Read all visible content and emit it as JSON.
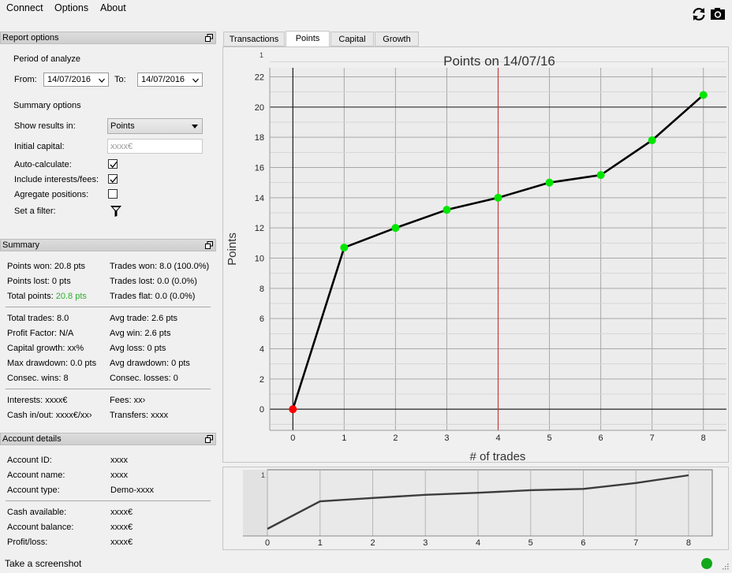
{
  "menu": [
    "Connect",
    "Options",
    "About"
  ],
  "toolbar": {
    "refresh_icon": "refresh-icon",
    "screenshot_icon": "camera-icon"
  },
  "report_options": {
    "header": "Report options",
    "period_label": "Period of analyze",
    "from_label": "From:",
    "from_value": "14/07/2016",
    "to_label": "To:",
    "to_value": "14/07/2016",
    "summary_options_label": "Summary options",
    "show_results_label": "Show results in:",
    "show_results_value": "Points",
    "initial_capital_label": "Initial capital:",
    "initial_capital_placeholder": "xxxx€",
    "auto_calc_label": "Auto-calculate:",
    "auto_calc_checked": true,
    "include_fees_label": "Include interests/fees:",
    "include_fees_checked": true,
    "aggregate_label": "Agregate positions:",
    "aggregate_checked": false,
    "filter_label": "Set a filter:"
  },
  "summary": {
    "header": "Summary",
    "points_won": "Points won: 20.8 pts",
    "trades_won": "Trades won: 8.0 (100.0%)",
    "points_lost": "Points lost: 0 pts",
    "trades_lost": "Trades lost: 0.0 (0.0%)",
    "total_points_label": "Total points:",
    "total_points_value": "20.8 pts",
    "trades_flat": "Trades flat: 0.0 (0.0%)",
    "total_trades": "Total trades: 8.0",
    "avg_trade": "Avg trade: 2.6 pts",
    "profit_factor": "Profit Factor: N/A",
    "avg_win": "Avg win: 2.6 pts",
    "capital_growth": "Capital growth: xx%",
    "avg_loss": "Avg loss: 0 pts",
    "max_drawdown": "Max drawdown: 0.0 pts",
    "avg_drawdown": "Avg drawdown: 0 pts",
    "consec_wins": "Consec. wins: 8",
    "consec_losses": "Consec. losses: 0",
    "interests": "Interests: xxxx€",
    "fees": "Fees: xx›",
    "cash_inout": "Cash in/out: xxxx€/xx›",
    "transfers": "Transfers: xxxx"
  },
  "account": {
    "header": "Account details",
    "rows1": [
      {
        "label": "Account ID:",
        "value": "xxxx"
      },
      {
        "label": "Account name:",
        "value": "xxxx"
      },
      {
        "label": "Account type:",
        "value": "Demo-xxxx"
      }
    ],
    "rows2": [
      {
        "label": "Cash available:",
        "value": "xxxx€"
      },
      {
        "label": "Account balance:",
        "value": "xxxx€"
      },
      {
        "label": "Profit/loss:",
        "value": "xxxx€"
      }
    ]
  },
  "tabs": [
    "Transactions",
    "Points",
    "Capital",
    "Growth"
  ],
  "active_tab": 1,
  "status": {
    "screenshot_label": "Take a screenshot",
    "status_color": "#11a819"
  },
  "chart_data": [
    {
      "type": "line",
      "title": "Points on 14/07/16",
      "xlabel": "# of trades",
      "ylabel": "Points",
      "x": [
        0,
        1,
        2,
        3,
        4,
        5,
        6,
        7,
        8
      ],
      "values": [
        0,
        10.7,
        12.0,
        13.2,
        14.0,
        15.0,
        15.5,
        17.8,
        20.8
      ],
      "xlim": [
        -0.45,
        8.45
      ],
      "ylim": [
        -1.4,
        22.6
      ],
      "yticks": [
        0,
        2,
        4,
        6,
        8,
        10,
        12,
        14,
        16,
        18,
        20,
        22
      ],
      "xticks": [
        0,
        1,
        2,
        3,
        4,
        5,
        6,
        7,
        8
      ],
      "corner_label": "1",
      "hline": 20,
      "vline": 4,
      "grid": true,
      "point_colors": {
        "first": "#ff0000",
        "rest": "#00e600"
      },
      "line_color": "#000000",
      "vline_color": "#c83c3c"
    },
    {
      "type": "line",
      "title": "",
      "x": [
        0,
        1,
        2,
        3,
        4,
        5,
        6,
        7,
        8
      ],
      "values": [
        0,
        10.7,
        12.0,
        13.2,
        14.0,
        15.0,
        15.5,
        17.8,
        20.8
      ],
      "xticks": [
        0,
        1,
        2,
        3,
        4,
        5,
        6,
        7,
        8
      ],
      "corner_label": "1",
      "line_color": "#3c3c3c"
    }
  ]
}
